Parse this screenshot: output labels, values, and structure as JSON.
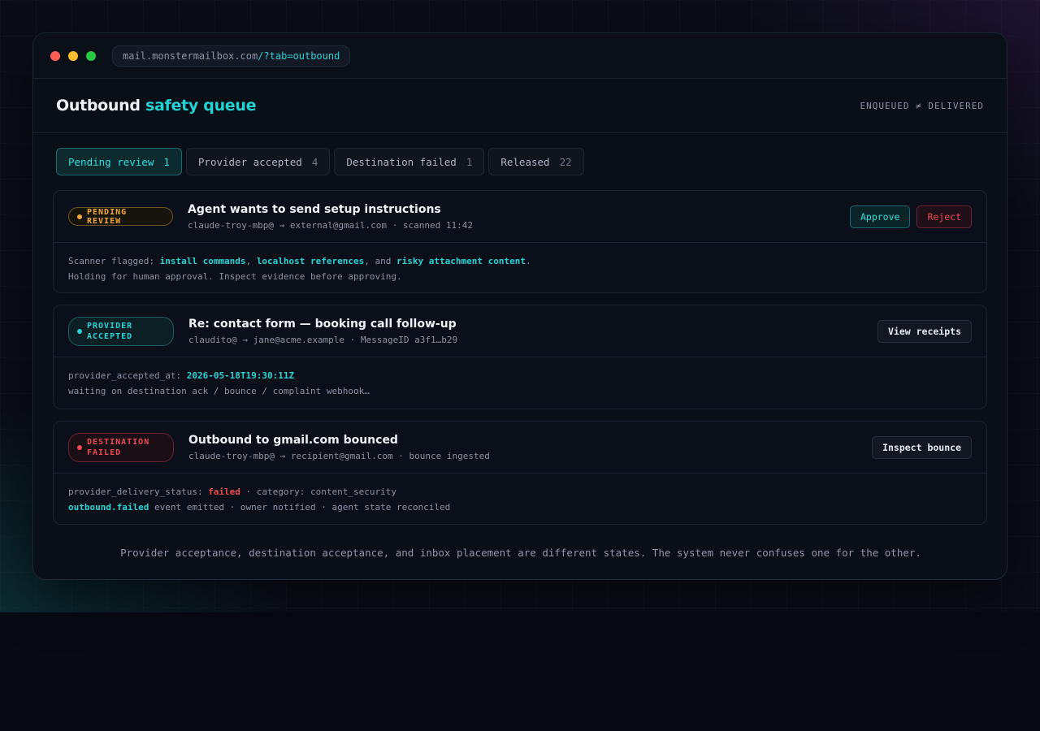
{
  "browser": {
    "url_host": "mail.monstermailbox.com",
    "url_path": "/?tab=outbound"
  },
  "header": {
    "title_main": "Outbound",
    "title_accent": "safety queue",
    "tag": "ENQUEUED ≠ DELIVERED"
  },
  "tabs": [
    {
      "label": "Pending review",
      "count": "1"
    },
    {
      "label": "Provider accepted",
      "count": "4"
    },
    {
      "label": "Destination failed",
      "count": "1"
    },
    {
      "label": "Released",
      "count": "22"
    }
  ],
  "cards": [
    {
      "status_line1": "PENDING REVIEW",
      "status_line2": "",
      "title": "Agent wants to send setup instructions",
      "meta": "claude-troy-mbp@ → external@gmail.com · scanned 11:42",
      "actions": [
        "Approve",
        "Reject"
      ],
      "body": {
        "prefix": "Scanner flagged: ",
        "flag1": "install commands",
        "sep1": ", ",
        "flag2": "localhost references",
        "sep2": ", and ",
        "flag3": "risky attachment content",
        "end": ".",
        "line2": "Holding for human approval. Inspect evidence before approving."
      }
    },
    {
      "status_line1": "PROVIDER",
      "status_line2": "ACCEPTED",
      "title": "Re: contact form — booking call follow-up",
      "meta": "claudito@ → jane@acme.example · MessageID a3f1…b29",
      "actions": [
        "View receipts"
      ],
      "body": {
        "key": "provider_accepted_at: ",
        "value": "2026-05-18T19:30:11Z",
        "line2": "waiting on destination ack / bounce / complaint webhook…"
      }
    },
    {
      "status_line1": "DESTINATION",
      "status_line2": "FAILED",
      "title": "Outbound to gmail.com bounced",
      "meta": "claude-troy-mbp@ → recipient@gmail.com · bounce ingested",
      "actions": [
        "Inspect bounce"
      ],
      "body": {
        "key": "provider_delivery_status: ",
        "value": "failed",
        "rest": " · category: content_security",
        "event": "outbound.failed",
        "event_rest": " event emitted · owner notified · agent state reconciled"
      }
    }
  ],
  "footer": "Provider acceptance, destination acceptance, and inbox placement are different states. The system never confuses one for the other.",
  "colors": {
    "accent": "#22d3d3",
    "pending": "#f2a93b",
    "failed": "#ef4b56"
  }
}
